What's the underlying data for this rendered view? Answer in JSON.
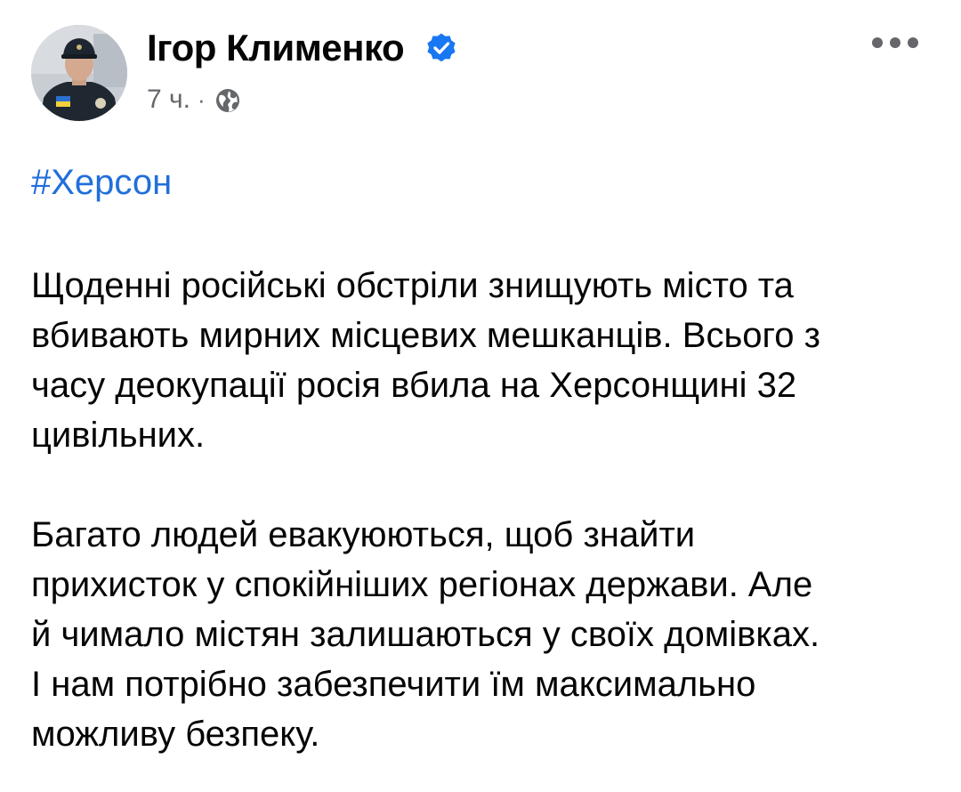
{
  "post": {
    "author": {
      "name": "Ігор Клименко",
      "verified": true,
      "avatar_icon": "user-avatar-photo"
    },
    "timestamp": "7 ч.",
    "separator": "·",
    "privacy_icon": "globe-icon",
    "menu_icon": "more-options-icon",
    "hashtag": "#Херсон",
    "paragraphs": [
      {
        "lines": [
          "Щоденні російські обстріли знищують місто та",
          "вбивають мирних місцевих мешканців. Всього з",
          "часу деокупації росія вбила на Херсонщині 32",
          "цивільних."
        ]
      },
      {
        "lines": [
          "Багато людей евакуюються, щоб знайти",
          "прихисток у спокійніших регіонах держави. Але",
          "й чимало містян залишаються у своїх домівках.",
          "І нам потрібно забезпечити їм максимально",
          "можливу безпеку."
        ]
      }
    ]
  },
  "colors": {
    "text": "#050505",
    "meta": "#65676b",
    "link": "#216fdb",
    "verified": "#1877f2"
  }
}
